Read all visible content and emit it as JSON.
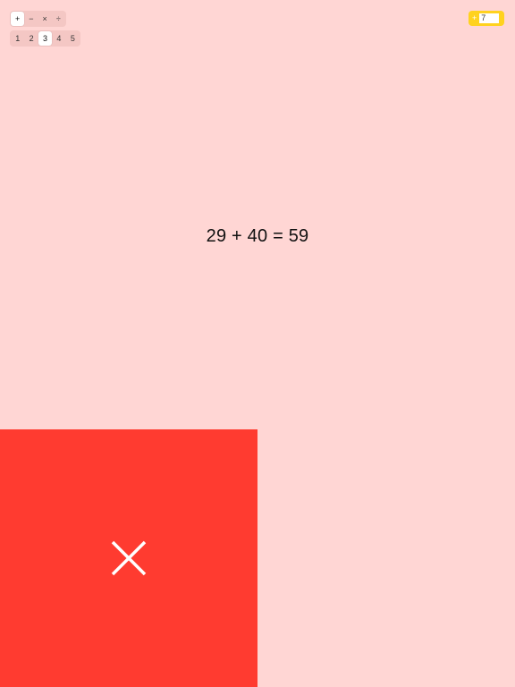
{
  "operations": {
    "options": [
      "+",
      "−",
      "×",
      "÷"
    ],
    "selected_index": 0
  },
  "levels": {
    "options": [
      "1",
      "2",
      "3",
      "4",
      "5"
    ],
    "selected_index": 2
  },
  "score": {
    "plus_label": "+",
    "value": "7"
  },
  "problem": {
    "equation": "29 + 40 = 59"
  },
  "feedback": {
    "result": "incorrect",
    "icon": "close-icon",
    "panel_color": "#ff3b30",
    "icon_color": "#ffffff"
  },
  "colors": {
    "background": "#ffd6d4",
    "score_pill": "#ffd21f"
  }
}
